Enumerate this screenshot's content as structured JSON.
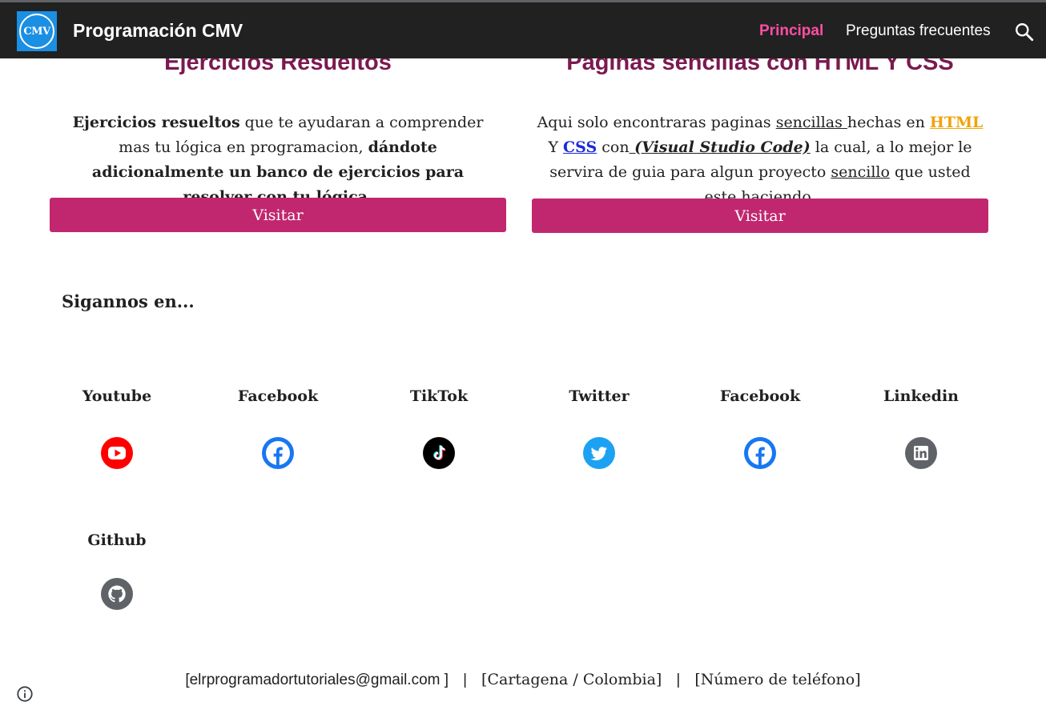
{
  "header": {
    "logo_text": "CMV",
    "site_title": "Programación CMV",
    "nav": [
      {
        "label": "Principal",
        "active": true
      },
      {
        "label": "Preguntas frecuentes",
        "active": false
      }
    ],
    "search_icon": "search-icon"
  },
  "cards": [
    {
      "title": "Ejercicios Resueltos",
      "desc_parts": {
        "bold1": "Ejercicios resueltos",
        "normal1": " que te ayudaran a comprender mas tu lógica en programacion, ",
        "bold2": "dándote adicionalmente un banco de ejercicios para resolver con tu lógica."
      },
      "button": "Visitar"
    },
    {
      "title": "Paginas sencillas con HTML Y CSS",
      "desc_parts": {
        "t1": "Aqui solo encontraras paginas ",
        "u1": "sencillas ",
        "t2": " hechas en ",
        "html": "HTML",
        "t3": " Y ",
        "css": "CSS",
        "t4": " con",
        "vsc": " (Visual Studio Code)",
        "t5": " la cual, a lo mejor le servira de guia para algun proyecto ",
        "u2": "sencillo",
        "t6": " que usted este haciendo."
      },
      "button": "Visitar"
    }
  ],
  "follow": {
    "title": "Sigannos en...",
    "items": [
      {
        "label": "Youtube",
        "icon": "youtube-icon",
        "color": "#ff0000"
      },
      {
        "label": "Facebook",
        "icon": "facebook-icon",
        "color": "#1877f2"
      },
      {
        "label": "TikTok",
        "icon": "tiktok-icon",
        "color": "#000000"
      },
      {
        "label": "Twitter",
        "icon": "twitter-icon",
        "color": "#1da1f2"
      },
      {
        "label": "Facebook",
        "icon": "facebook-icon",
        "color": "#1877f2"
      },
      {
        "label": "Linkedin",
        "icon": "linkedin-icon",
        "color": "#5f6368"
      },
      {
        "label": "Github",
        "icon": "github-icon",
        "color": "#5f6368"
      }
    ]
  },
  "footer": {
    "email": "[elrprogramadortutoriales@gmail.com ]",
    "sep": "|",
    "location": "[Cartagena / Colombia]",
    "phone": "[Número de teléfono]"
  },
  "colors": {
    "header_bg": "#212121",
    "active_nav": "#ff4fa3",
    "title": "#7a1a4f",
    "button": "#c1276f",
    "html_link": "#f0a30a",
    "css_link": "#1a2adb"
  }
}
